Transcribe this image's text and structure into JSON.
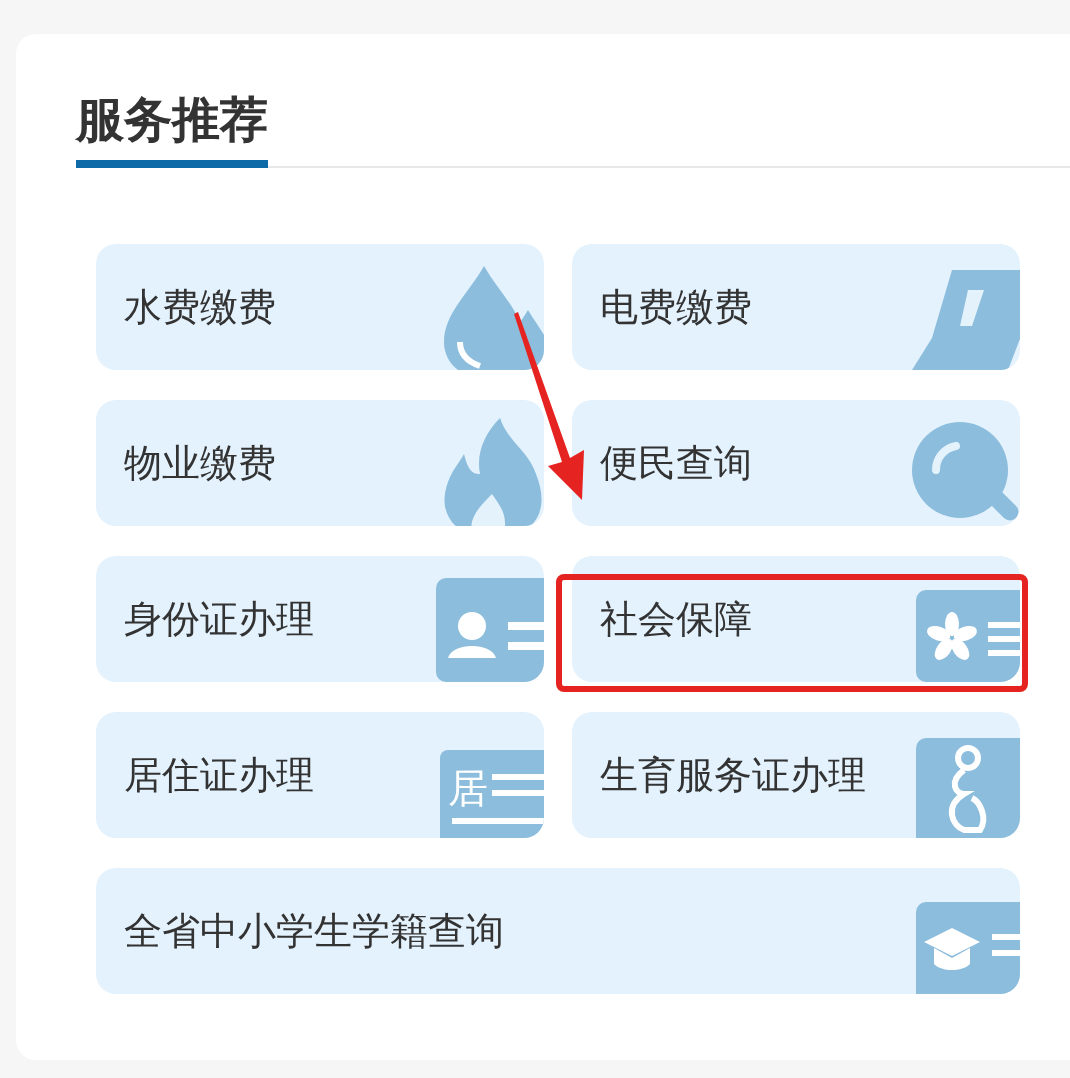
{
  "panel": {
    "title": "服务推荐"
  },
  "services": [
    {
      "label": "水费缴费",
      "wide": false,
      "highlighted": false
    },
    {
      "label": "电费缴费",
      "wide": false,
      "highlighted": false
    },
    {
      "label": "物业缴费",
      "wide": false,
      "highlighted": false
    },
    {
      "label": "便民查询",
      "wide": false,
      "highlighted": false
    },
    {
      "label": "身份证办理",
      "wide": false,
      "highlighted": false
    },
    {
      "label": "社会保障",
      "wide": false,
      "highlighted": true
    },
    {
      "label": "居住证办理",
      "icon_text": "居",
      "wide": false,
      "highlighted": false
    },
    {
      "label": "生育服务证办理",
      "wide": false,
      "highlighted": false
    },
    {
      "label": "全省中小学生学籍查询",
      "wide": true,
      "highlighted": false
    }
  ],
  "annotations": [
    {
      "kind": "arrow"
    }
  ]
}
